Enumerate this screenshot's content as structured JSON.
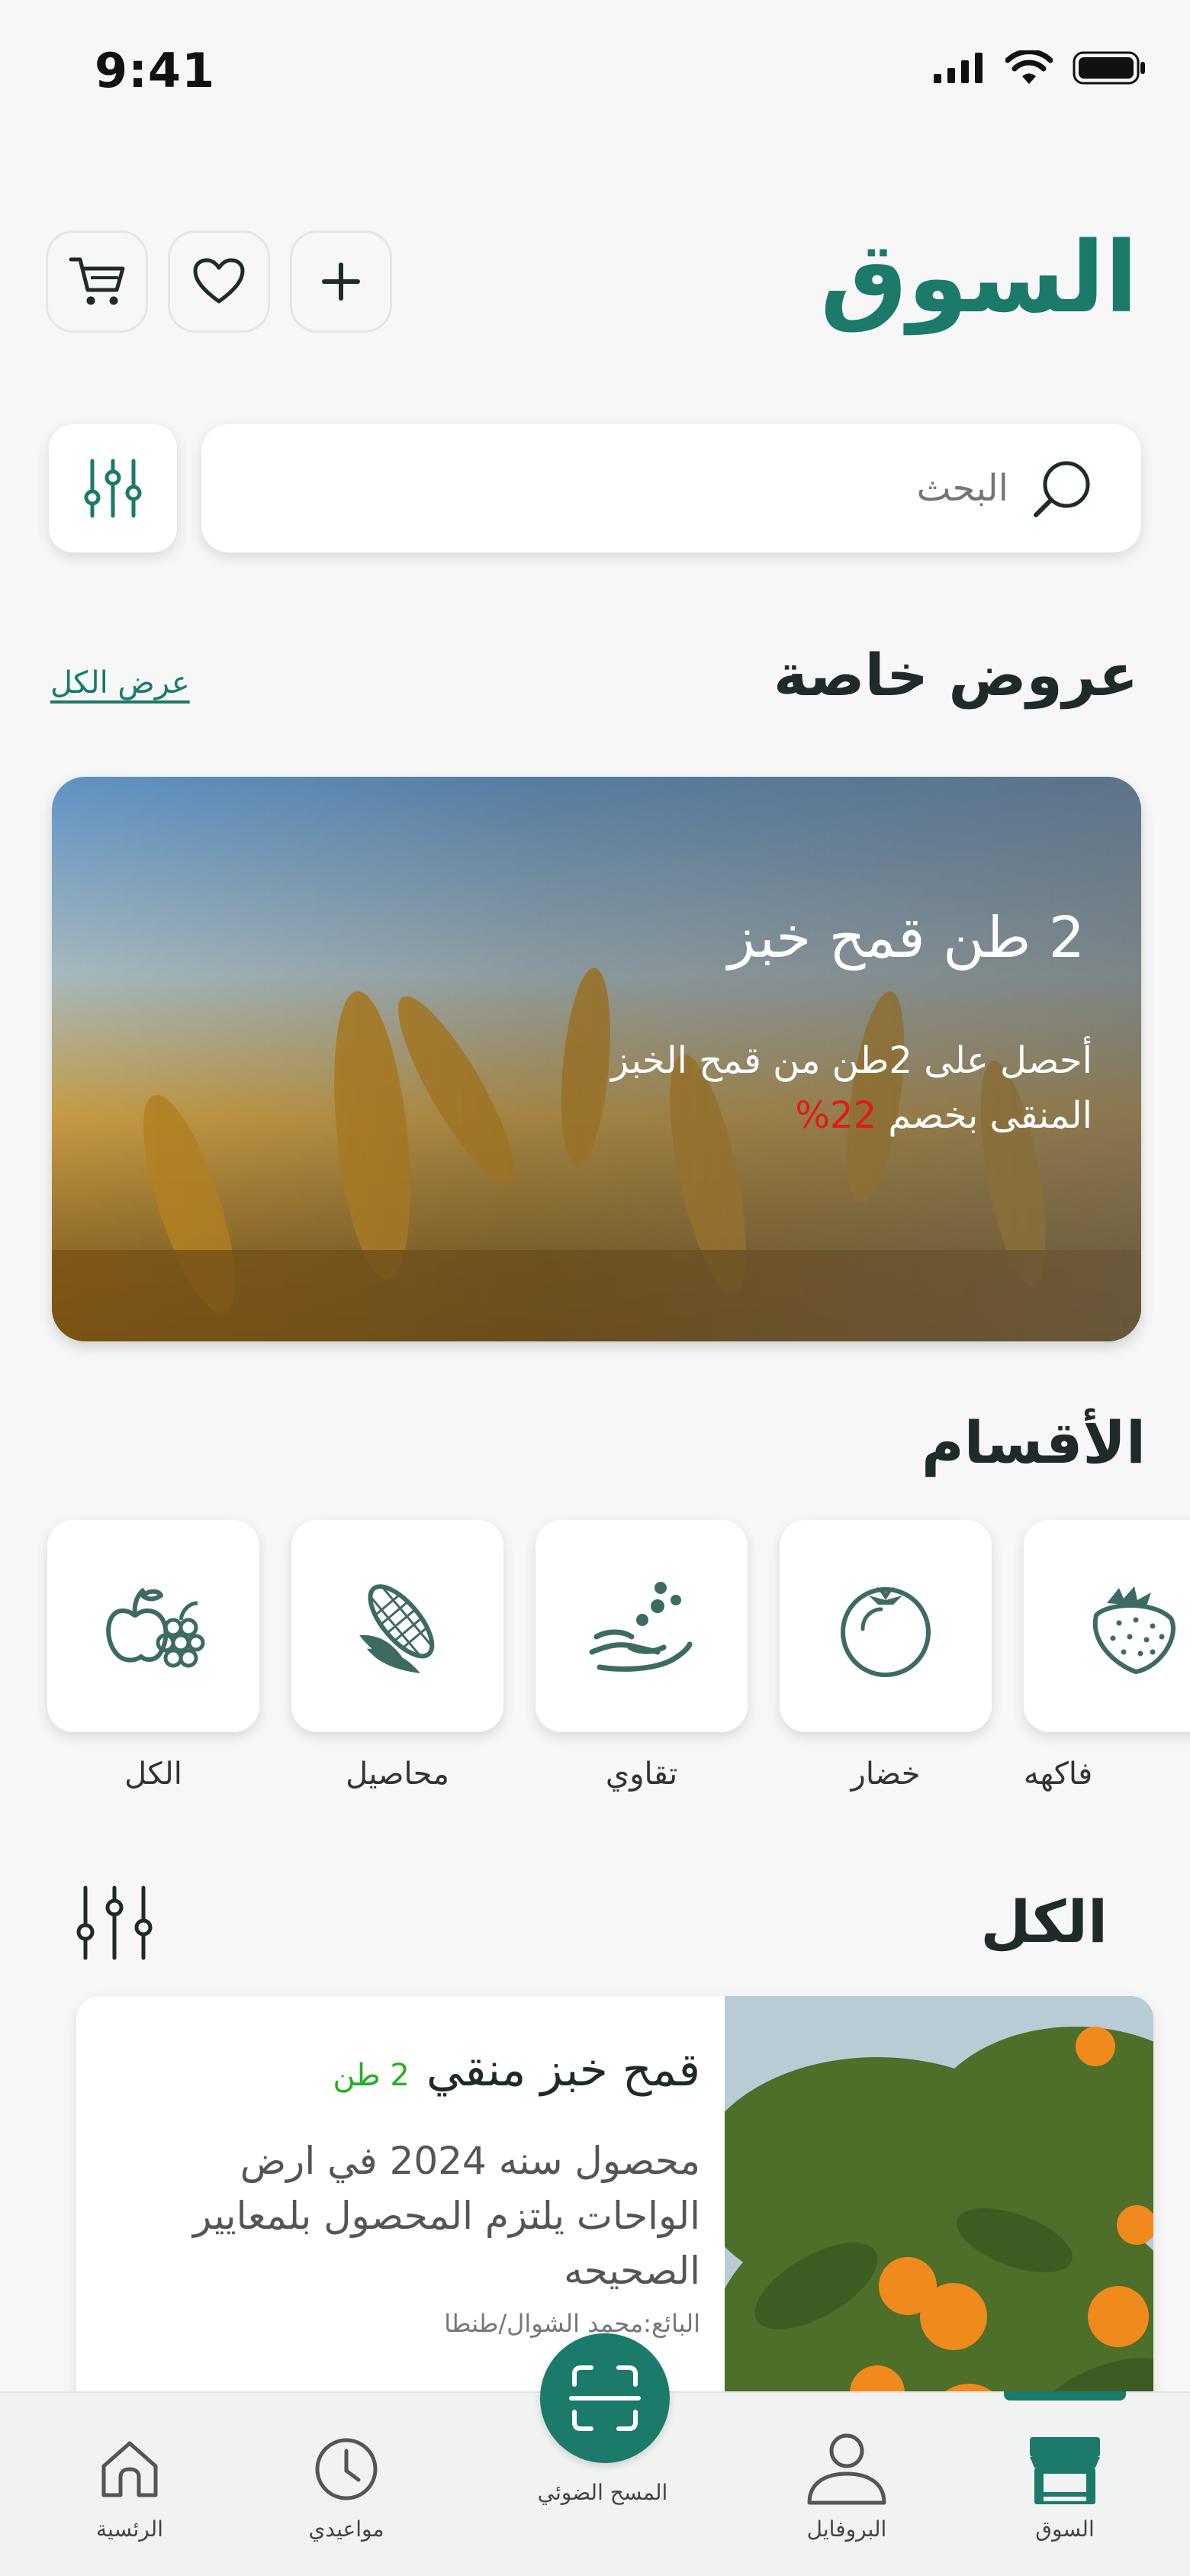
{
  "status_bar": {
    "time": "9:41"
  },
  "header": {
    "title": "السوق"
  },
  "search": {
    "placeholder": "البحث"
  },
  "special_offers": {
    "title": "عروض خاصة",
    "view_all": "عرض الكل",
    "banner": {
      "title": "2 طن قمح خبز",
      "description": "أحصل على 2طن من قمح الخبز المنقى بخصم",
      "discount": "22%"
    }
  },
  "categories": {
    "title": "الأقسام",
    "items": [
      {
        "label": "الكل",
        "icon": "fruit-basket-icon"
      },
      {
        "label": "محاصيل",
        "icon": "corn-icon"
      },
      {
        "label": "تقاوي",
        "icon": "seeds-hand-icon"
      },
      {
        "label": "خضار",
        "icon": "tomato-icon"
      },
      {
        "label": "فاكهه",
        "icon": "strawberry-icon"
      }
    ]
  },
  "all_products": {
    "title": "الكل",
    "items": [
      {
        "title": "قمح خبز منقي",
        "quantity": "2 طن",
        "description": "محصول سنه 2024 في ارض الواحات يلتزم المحصول بلمعايير الصحيحه",
        "seller": "البائع:محمد الشوال/طنطا"
      }
    ]
  },
  "bottom_nav": {
    "items": [
      {
        "label": "الرئسية",
        "icon": "home-icon"
      },
      {
        "label": "مواعيدي",
        "icon": "clock-icon"
      },
      {
        "label": "المسح الضوئي",
        "icon": "scan-icon"
      },
      {
        "label": "البروفايل",
        "icon": "user-icon"
      },
      {
        "label": "السوق",
        "icon": "store-icon"
      }
    ],
    "active": "السوق"
  },
  "colors": {
    "primary": "#1b7a6a",
    "discount": "#e01b1b",
    "quantity": "#25b027"
  }
}
